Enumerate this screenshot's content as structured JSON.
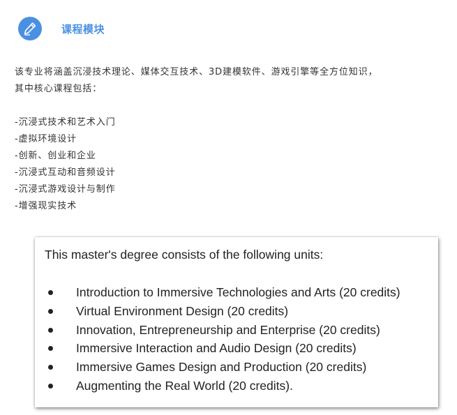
{
  "header": {
    "icon": "pencil-icon",
    "accent_color": "#4a90e2",
    "title": "课程模块"
  },
  "intro": {
    "line1": "该专业将涵盖沉浸技术理论、媒体交互技术、3D建模软件、游戏引擎等全方位知识，",
    "line2": "其中核心课程包括："
  },
  "chinese_courses": [
    "-沉浸式技术和艺术入门",
    "-虚拟环境设计",
    "-创新、创业和企业",
    "-沉浸式互动和音频设计",
    "-沉浸式游戏设计与制作",
    "-增强现实技术"
  ],
  "english_card": {
    "title": "This master's degree consists of the following units:",
    "units": [
      "Introduction to Immersive Technologies and Arts (20 credits)",
      "Virtual Environment Design (20 credits)",
      "Innovation, Entrepreneurship and Enterprise (20 credits)",
      "Immersive Interaction and Audio Design (20 credits)",
      "Immersive Games Design and Production (20 credits)",
      "Augmenting the Real World (20 credits)."
    ]
  }
}
